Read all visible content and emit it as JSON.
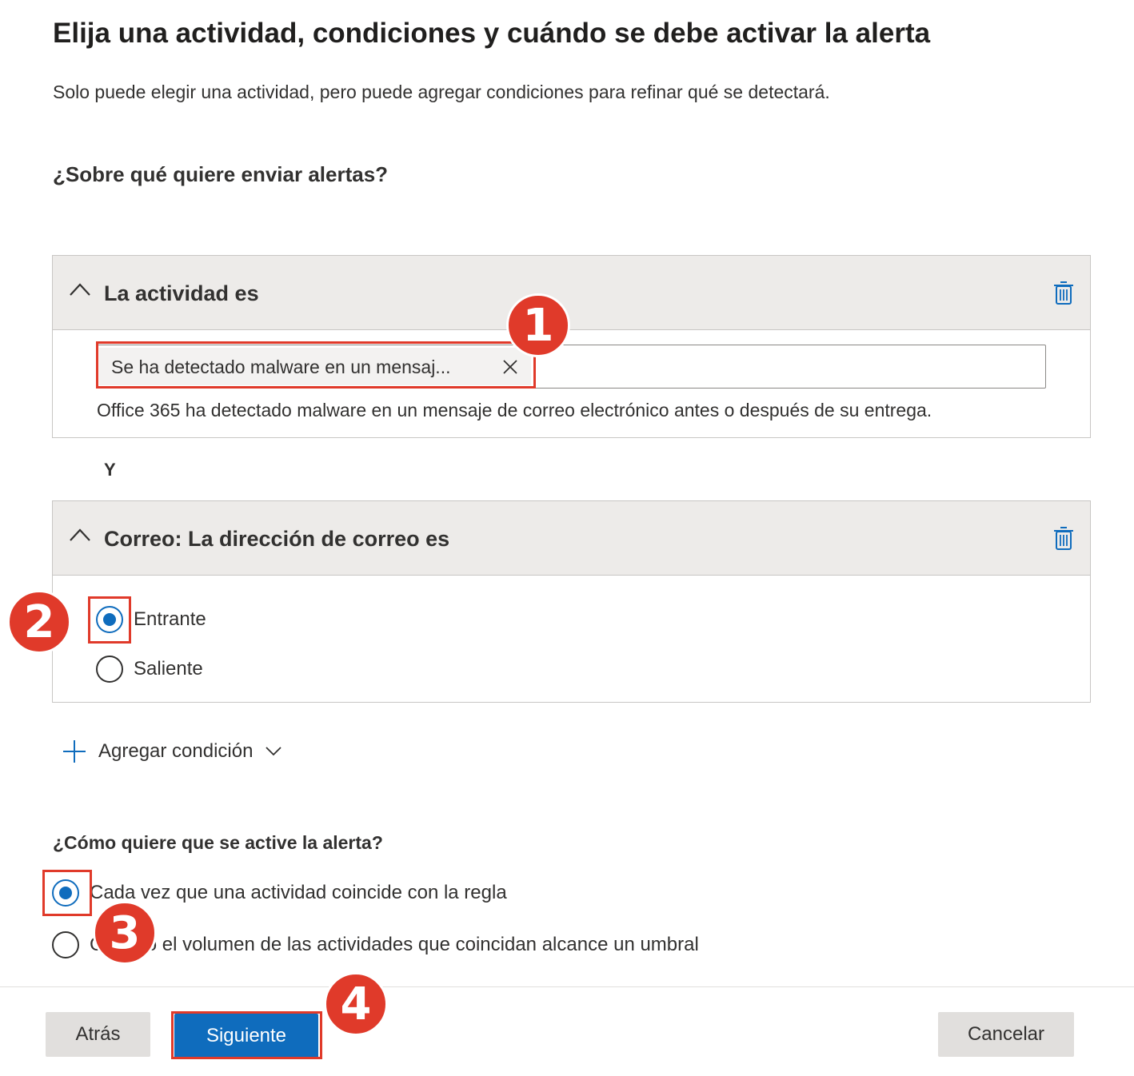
{
  "header": {
    "title": "Elija una actividad, condiciones y cuándo se debe activar la alerta",
    "subtitle": "Solo puede elegir una actividad, pero puede agregar condiciones para refinar qué se detectará."
  },
  "question_activity": "¿Sobre qué quiere enviar alertas?",
  "activity_panel": {
    "title": "La actividad es",
    "selected_tag": "Se ha detectado malware en un mensaj...",
    "description": "Office 365 ha detectado malware en un mensaje de correo electrónico antes o después de su entrega."
  },
  "and_label": "Y",
  "mail_panel": {
    "title": "Correo: La dirección de correo es",
    "options": [
      {
        "label": "Entrante",
        "checked": true
      },
      {
        "label": "Saliente",
        "checked": false
      }
    ]
  },
  "add_condition_label": "Agregar condición",
  "trigger": {
    "question": "¿Cómo quiere que se active la alerta?",
    "options": [
      {
        "label": "Cada vez que una actividad coincide con la regla",
        "checked": true
      },
      {
        "label": "Cuando el volumen de las actividades que coincidan alcance un umbral",
        "checked": false
      }
    ]
  },
  "footer": {
    "back_label": "Atrás",
    "next_label": "Siguiente",
    "cancel_label": "Cancelar"
  },
  "annotations": {
    "color": "#e03a2a",
    "steps": [
      "1",
      "2",
      "3",
      "4"
    ]
  },
  "colors": {
    "accent": "#0f6cbd",
    "panel_header": "#edebe9"
  },
  "icons": [
    "chevron-up-icon",
    "trash-icon",
    "close-icon",
    "plus-icon",
    "chevron-down-icon"
  ]
}
